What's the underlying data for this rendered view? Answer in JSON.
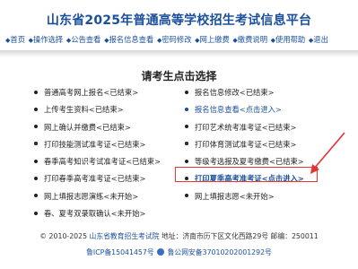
{
  "header": {
    "title": "山东省2025年普通高等学校招生考试信息平台",
    "nav": [
      "首页",
      "操作选择",
      "公告查看",
      "报名信息查看",
      "密码修改",
      "网上缴费",
      "缴费说明",
      "使用帮助",
      "退出"
    ]
  },
  "panel": {
    "title": "请考生点击选择",
    "left_items": [
      {
        "label": "普通高考网上报名<已结束>",
        "style": "normal"
      },
      {
        "label": "上传考生资料<已结束>",
        "style": "normal"
      },
      {
        "label": "网上确认并缴费<已结束>",
        "style": "normal"
      },
      {
        "label": "打印技能测试准考证<已结束>",
        "style": "normal"
      },
      {
        "label": "春季高考知识考试准考证<已结束>",
        "style": "normal"
      },
      {
        "label": "打印春季高考准考证<已结束>",
        "style": "normal"
      },
      {
        "label": "网上填报志愿演练<未开始>",
        "style": "normal"
      },
      {
        "label": "春、夏考双录取确认<未开始>",
        "style": "normal"
      }
    ],
    "right_items": [
      {
        "label": "报名信息修改<已结束>",
        "style": "normal"
      },
      {
        "label": "报名信息查看<点击进入>",
        "style": "link"
      },
      {
        "label": "打印艺术统考准考证<已结束>",
        "style": "normal"
      },
      {
        "label": "打印体育测试准考证<已结束>",
        "style": "normal"
      },
      {
        "label": "等级考选报及夏考缴费<已结束>",
        "style": "normal"
      },
      {
        "label": "打印夏季高考准考证<点击进入>",
        "style": "highlight"
      },
      {
        "label": "网上填报志愿<未开始>",
        "style": "normal"
      }
    ]
  },
  "footer": {
    "copyright": "© 2010-2025",
    "org": "山东省教育招生考试院",
    "address": "地址：济南市历下区文化西路29号 邮编：250011",
    "icp": "鲁ICP备15041457号",
    "police": "鲁公网安备37010202001292号"
  },
  "colors": {
    "brand": "#1a4f9c",
    "highlight_border": "#e33333",
    "arrow": "#e33333"
  }
}
